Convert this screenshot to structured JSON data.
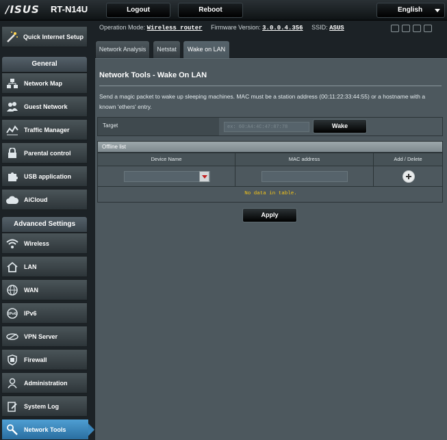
{
  "header": {
    "brand": "/ISUS",
    "model": "RT-N14U",
    "logout_label": "Logout",
    "reboot_label": "Reboot",
    "language": "English"
  },
  "info": {
    "operation_mode_label": "Operation Mode:",
    "operation_mode_value": "Wireless router",
    "firmware_label": "Firmware Version:",
    "firmware_value": "3.0.0.4.356",
    "ssid_label": "SSID:",
    "ssid_value": "ASUS"
  },
  "sidebar": {
    "quick_setup": "Quick Internet Setup",
    "general_header": "General",
    "general_items": [
      {
        "label": "Network Map",
        "icon": "network-map-icon"
      },
      {
        "label": "Guest Network",
        "icon": "guest-network-icon"
      },
      {
        "label": "Traffic Manager",
        "icon": "traffic-manager-icon"
      },
      {
        "label": "Parental control",
        "icon": "parental-control-icon"
      },
      {
        "label": "USB application",
        "icon": "usb-application-icon"
      },
      {
        "label": "AiCloud",
        "icon": "aicloud-icon"
      }
    ],
    "advanced_header": "Advanced Settings",
    "advanced_items": [
      {
        "label": "Wireless",
        "icon": "wireless-icon"
      },
      {
        "label": "LAN",
        "icon": "lan-icon"
      },
      {
        "label": "WAN",
        "icon": "wan-icon"
      },
      {
        "label": "IPv6",
        "icon": "ipv6-icon"
      },
      {
        "label": "VPN Server",
        "icon": "vpn-server-icon"
      },
      {
        "label": "Firewall",
        "icon": "firewall-icon"
      },
      {
        "label": "Administration",
        "icon": "administration-icon"
      },
      {
        "label": "System Log",
        "icon": "system-log-icon"
      },
      {
        "label": "Network Tools",
        "icon": "network-tools-icon",
        "active": true
      }
    ]
  },
  "tabs": [
    {
      "label": "Network Analysis"
    },
    {
      "label": "Netstat"
    },
    {
      "label": "Wake on LAN",
      "active": true
    }
  ],
  "content": {
    "title": "Network Tools - Wake On LAN",
    "description": "Send a magic packet to wake up sleeping machines. MAC must be a station address (00:11:22:33:44:55) or a hostname with a known 'ethers' entry.",
    "target_label": "Target",
    "target_placeholder": "ex: 60:A4:4C:47:87:78",
    "wake_label": "Wake",
    "offline_list_label": "Offline list",
    "columns": [
      "Device Name",
      "MAC address",
      "Add / Delete"
    ],
    "no_data": "No data in table.",
    "apply_label": "Apply"
  },
  "colors": {
    "active_menu": "#3a85ba",
    "no_data_text": "#f5c518",
    "panel_bg": "#4d585e"
  }
}
